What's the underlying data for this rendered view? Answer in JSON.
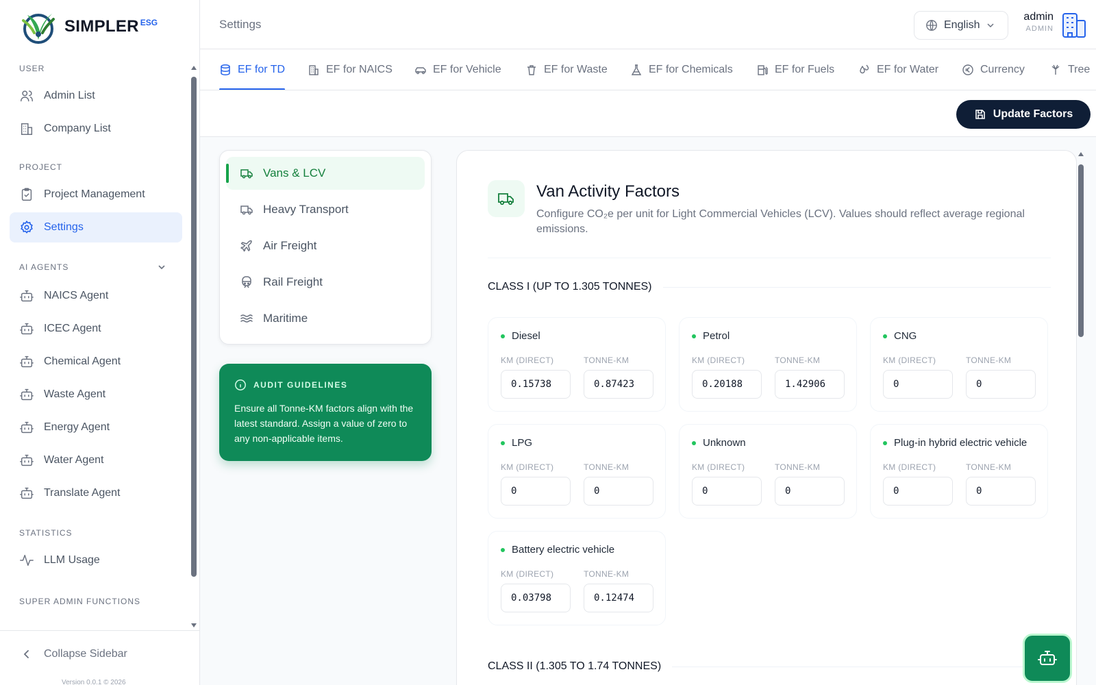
{
  "brand": {
    "name": "SIMPLER",
    "sup": "ESG"
  },
  "sidebar": {
    "sections": [
      {
        "title": "USER",
        "items": [
          {
            "label": "Admin List",
            "icon": "users-icon"
          },
          {
            "label": "Company List",
            "icon": "building-icon"
          }
        ]
      },
      {
        "title": "PROJECT",
        "items": [
          {
            "label": "Project Management",
            "icon": "clipboard-icon"
          },
          {
            "label": "Settings",
            "icon": "gear-icon",
            "active": true
          }
        ]
      },
      {
        "title": "AI AGENTS",
        "collapsible": true,
        "items": [
          {
            "label": "NAICS Agent",
            "icon": "bot-icon"
          },
          {
            "label": "ICEC Agent",
            "icon": "bot-icon"
          },
          {
            "label": "Chemical Agent",
            "icon": "bot-icon"
          },
          {
            "label": "Waste Agent",
            "icon": "bot-icon"
          },
          {
            "label": "Energy Agent",
            "icon": "bot-icon"
          },
          {
            "label": "Water Agent",
            "icon": "bot-icon"
          },
          {
            "label": "Translate Agent",
            "icon": "bot-icon"
          }
        ]
      },
      {
        "title": "STATISTICS",
        "items": [
          {
            "label": "LLM Usage",
            "icon": "activity-icon"
          }
        ]
      },
      {
        "title": "SUPER ADMIN FUNCTIONS",
        "items": []
      }
    ],
    "collapse_label": "Collapse Sidebar",
    "version": "Version 0.0.1 © 2026"
  },
  "header": {
    "breadcrumb": "Settings",
    "language": "English",
    "user_name": "admin",
    "user_role": "ADMIN"
  },
  "tabs": [
    {
      "label": "EF for TD",
      "icon": "database-icon",
      "active": true
    },
    {
      "label": "EF for NAICS",
      "icon": "building-icon"
    },
    {
      "label": "EF for Vehicle",
      "icon": "car-icon"
    },
    {
      "label": "EF for Waste",
      "icon": "trash-icon"
    },
    {
      "label": "EF for Chemicals",
      "icon": "flask-icon"
    },
    {
      "label": "EF for Fuels",
      "icon": "fuel-icon"
    },
    {
      "label": "EF for Water",
      "icon": "droplets-icon"
    },
    {
      "label": "Currency",
      "icon": "euro-icon"
    },
    {
      "label": "Tree",
      "icon": "tree-icon"
    }
  ],
  "toolbar": {
    "update_label": "Update Factors"
  },
  "categories": [
    {
      "label": "Vans & LCV",
      "icon": "truck-icon",
      "active": true
    },
    {
      "label": "Heavy Transport",
      "icon": "truck-icon"
    },
    {
      "label": "Air Freight",
      "icon": "plane-icon"
    },
    {
      "label": "Rail Freight",
      "icon": "train-icon"
    },
    {
      "label": "Maritime",
      "icon": "waves-icon"
    }
  ],
  "guidelines": {
    "title": "AUDIT GUIDELINES",
    "text": "Ensure all Tonne-KM factors align with the latest standard. Assign a value of zero to any non-applicable items."
  },
  "panel": {
    "title": "Van Activity Factors",
    "description": "Configure CO₂e per unit for Light Commercial Vehicles (LCV). Values should reflect average regional emissions."
  },
  "classes": [
    {
      "title": "CLASS I (UP TO 1.305 TONNES)",
      "col1": "KM (DIRECT)",
      "col2": "TONNE-KM",
      "fuels": [
        {
          "name": "Diesel",
          "km": "0.15738",
          "tkm": "0.87423"
        },
        {
          "name": "Petrol",
          "km": "0.20188",
          "tkm": "1.42906"
        },
        {
          "name": "CNG",
          "km": "0",
          "tkm": "0"
        },
        {
          "name": "LPG",
          "km": "0",
          "tkm": "0"
        },
        {
          "name": "Unknown",
          "km": "0",
          "tkm": "0"
        },
        {
          "name": "Plug-in hybrid electric vehicle",
          "km": "0",
          "tkm": "0"
        },
        {
          "name": "Battery electric vehicle",
          "km": "0.03798",
          "tkm": "0.12474"
        }
      ]
    },
    {
      "title": "CLASS II (1.305 TO 1.74 TONNES)"
    }
  ],
  "colors": {
    "primary": "#2563eb",
    "green": "#0f8a58",
    "dark": "#0f1e36"
  }
}
